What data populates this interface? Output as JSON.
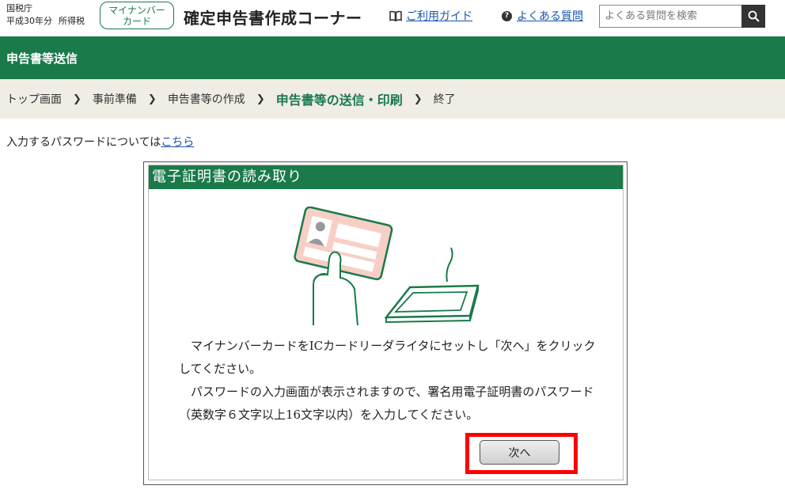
{
  "header": {
    "agency": "国税庁",
    "year": "平成30年分",
    "tax_type": "所得税",
    "mynumber_line1": "マイナンバー",
    "mynumber_line2": "カード",
    "site_title": "確定申告書作成コーナー",
    "guide_label": "ご利用ガイド",
    "faq_label": "よくある質問",
    "search_placeholder": "よくある質問を検索"
  },
  "section_title": "申告書等送信",
  "breadcrumb": {
    "steps": [
      "トップ画面",
      "事前準備",
      "申告書等の作成",
      "申告書等の送信・印刷",
      "終了"
    ],
    "current_index": 3
  },
  "password_note": {
    "text": "入力するパスワードについては",
    "link": "こちら"
  },
  "dialog": {
    "title": "電子証明書の読み取り",
    "message_1": "マイナンバーカードをICカードリーダライタにセットし「次へ」をクリックしてください。",
    "message_2": "パスワードの入力画面が表示されますので、署名用電子証明書のパスワード（英数字６文字以上16文字以内）を入力してください。",
    "next_label": "次へ"
  },
  "colors": {
    "brand_green": "#1a7a4a",
    "highlight_red": "#ff0000",
    "card_pink": "#f7cfc6"
  },
  "icons": {
    "guide": "book-icon",
    "faq": "question-circle-icon",
    "search": "magnifier-icon"
  }
}
